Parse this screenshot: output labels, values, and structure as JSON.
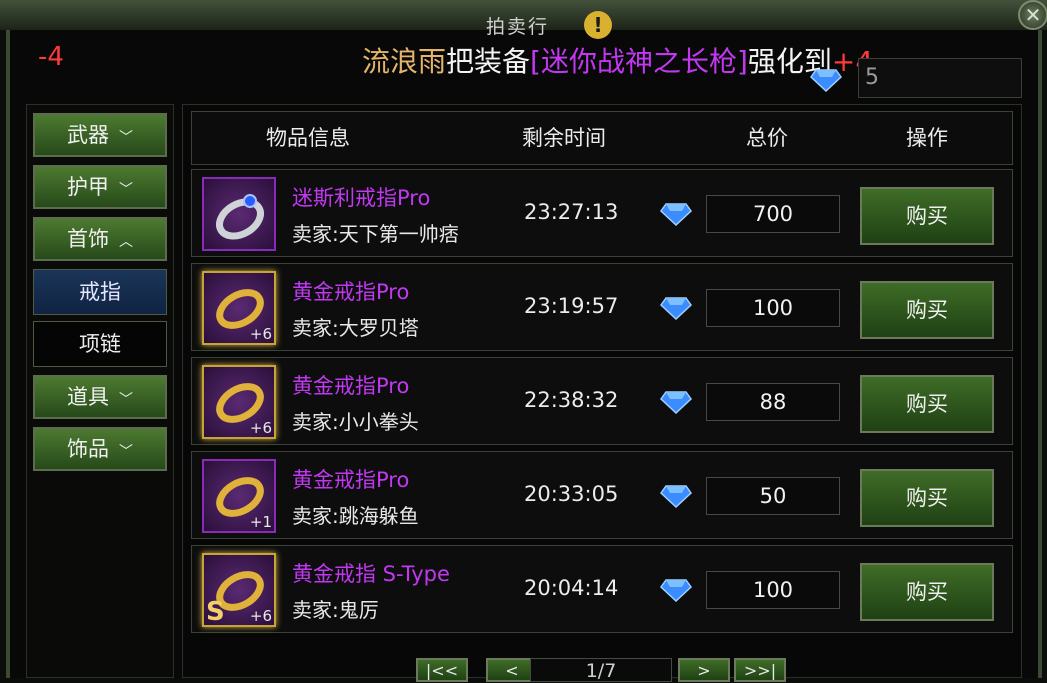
{
  "window": {
    "title": "拍卖行"
  },
  "ticker": {
    "left_tail": "-4",
    "player": "流浪雨",
    "mid": "把装备",
    "item": "[迷你战神之长枪]",
    "tail": "强化到",
    "level": "+4"
  },
  "balance": {
    "value": "5"
  },
  "sidebar": {
    "items": [
      {
        "label": "武器",
        "type": "category",
        "chevron": "down"
      },
      {
        "label": "护甲",
        "type": "category",
        "chevron": "down"
      },
      {
        "label": "首饰",
        "type": "category",
        "chevron": "up"
      },
      {
        "label": "戒指",
        "type": "sub",
        "active": true
      },
      {
        "label": "项链",
        "type": "sub",
        "active": false
      },
      {
        "label": "道具",
        "type": "category",
        "chevron": "down"
      },
      {
        "label": "饰品",
        "type": "category",
        "chevron": "down"
      }
    ]
  },
  "table": {
    "headers": {
      "info": "物品信息",
      "time": "剩余时间",
      "price": "总价",
      "action": "操作"
    },
    "rows": [
      {
        "name": "迷斯利戒指Pro",
        "seller": "卖家:天下第一帅痞",
        "time": "23:27:13",
        "price": "700",
        "buy": "购买",
        "badge": "",
        "frame": "purple",
        "icon": "silver-ring-icon"
      },
      {
        "name": "黄金戒指Pro",
        "seller": "卖家:大罗贝塔",
        "time": "23:19:57",
        "price": "100",
        "buy": "购买",
        "badge": "+6",
        "frame": "gold",
        "icon": "gold-ring-icon"
      },
      {
        "name": "黄金戒指Pro",
        "seller": "卖家:小小拳头",
        "time": "22:38:32",
        "price": "88",
        "buy": "购买",
        "badge": "+6",
        "frame": "gold",
        "icon": "gold-ring-icon"
      },
      {
        "name": "黄金戒指Pro",
        "seller": "卖家:跳海躲鱼",
        "time": "20:33:05",
        "price": "50",
        "buy": "购买",
        "badge": "+1",
        "frame": "purple",
        "icon": "gold-ring-icon"
      },
      {
        "name": "黄金戒指 S-Type",
        "seller": "卖家:鬼厉",
        "time": "20:04:14",
        "price": "100",
        "buy": "购买",
        "badge": "+6",
        "frame": "gold",
        "icon": "gold-ring-icon",
        "grade": "S"
      }
    ]
  },
  "pager": {
    "first": "|<<",
    "prev": "<",
    "page": "1/7",
    "next": ">",
    "last": ">>|"
  },
  "colors": {
    "item_purple": "#c238f2",
    "player_gold": "#e3b469",
    "level_red": "#ff3a3a",
    "button_green": "#3f6c27"
  }
}
